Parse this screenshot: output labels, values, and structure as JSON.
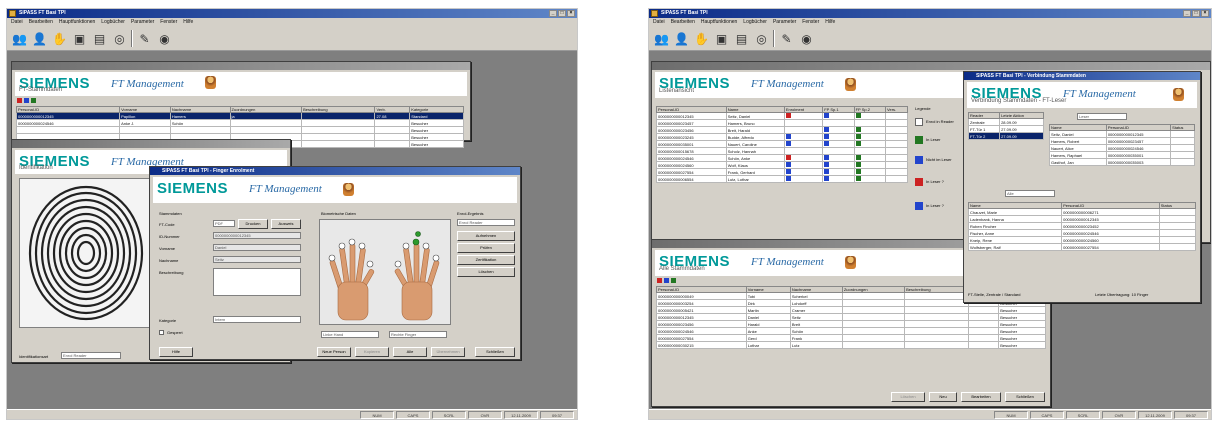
{
  "left": {
    "main_title": "SIPASS FT Basi TPI",
    "menu": [
      "Datei",
      "Bearbeiten",
      "Hauptfunktionen",
      "Logbücher",
      "Parameter",
      "Fenster",
      "Hilfe"
    ],
    "toolbar_icons": [
      "users-icon",
      "person-icon",
      "hands-icon",
      "device-icon",
      "building-icon",
      "disc-icon",
      "separator",
      "book-icon",
      "globe-icon"
    ],
    "brand": "SIEMENS",
    "product": "FT Management",
    "person_window": {
      "subtitle": "FT-Stammdaten",
      "columns": [
        "Personal-ID",
        "Vorname",
        "Nachname",
        "Zuordnungen",
        "Beschreibung",
        "Verb.",
        "Kategorie"
      ],
      "rows": [
        [
          "0000000000012345",
          "Papillon",
          "Hamers",
          "ja",
          "",
          "27.08",
          "Standard"
        ],
        [
          "0000000000024546",
          "Anke J.",
          "Schön",
          "",
          "",
          "",
          "Besucher"
        ],
        [
          "",
          "",
          "",
          "",
          "",
          "",
          "Besucher"
        ],
        [
          "",
          "",
          "",
          "",
          "",
          "",
          "Besucher"
        ],
        [
          "",
          "",
          "",
          "",
          "",
          "",
          "Besucher"
        ]
      ]
    },
    "ident_window": {
      "subtitle": "Identifikation",
      "field_label": "Identifikationsart",
      "field_value": "Enrol Reader"
    },
    "enrol_window": {
      "title": "SIPASS FT Basi TPI - Finger Enrolment",
      "subtitle": "Stammdaten",
      "group_left": "Stammdaten",
      "group_right": "Biometrische Daten",
      "labels": [
        "FT-Code",
        "ID-Nummer",
        "Vorname",
        "Nachname",
        "Beschreibung",
        "Kategorie"
      ],
      "values": [
        "PDF",
        "0000000000012345",
        "Daniel",
        "Seitz",
        "",
        "Intern"
      ],
      "code_buttons": [
        "Drucken",
        "Ausweis"
      ],
      "checkbox_label": "Gesperrt",
      "enrol_label": "Enrol-Ergebnis",
      "enrol_value": "Enrol Reader",
      "side_buttons": [
        "Aufnehmen",
        "Prüfen",
        "Zertifikation",
        "Löschen"
      ],
      "finger_left": "Linke Hand",
      "finger_right": "Rechte Finger",
      "bottom_buttons": [
        "Hilfe",
        "Neue Person",
        "Kopieren",
        "Alle",
        "Übernehmen",
        "Schließen"
      ]
    },
    "status": [
      "NUM",
      "CAPS",
      "SCRL",
      "OVR",
      "12.11.2009",
      "09:37"
    ]
  },
  "right": {
    "main_title": "SIPASS FT Basi TPI",
    "menu": [
      "Datei",
      "Bearbeiten",
      "Hauptfunktionen",
      "Logbücher",
      "Parameter",
      "Fenster",
      "Hilfe"
    ],
    "toolbar_icons": [
      "users-icon",
      "person-icon",
      "hands-icon",
      "device-icon",
      "building-icon",
      "disc-icon",
      "separator",
      "book-icon",
      "globe-icon"
    ],
    "brand": "SIEMENS",
    "product": "FT Management",
    "list_window": {
      "subtitle": "Listenansicht",
      "columns": [
        "Personal-ID",
        "Name",
        "Enrolment",
        "FP Sp.1",
        "FP Sp.2",
        "Vers."
      ],
      "rows": [
        [
          "0000000000012345",
          "Seitz, Daniel",
          "red",
          "blue",
          "green"
        ],
        [
          "0000000000023457",
          "Hamers, Bruno",
          "",
          "",
          ""
        ],
        [
          "0000000000023456",
          "Breit, Harald",
          "",
          "blue",
          "green"
        ],
        [
          "0000000000023245",
          "Budde, Alfredo",
          "blue",
          "blue",
          "green"
        ],
        [
          "0000000000035001",
          "Nauert, Caroline",
          "blue",
          "blue",
          "green"
        ],
        [
          "0000000000015678",
          "Scholz, Hannah",
          "",
          "",
          ""
        ],
        [
          "0000000000024546",
          "Schön, Anke",
          "red",
          "blue",
          "green"
        ],
        [
          "0000000000024560",
          "Wolf, Klaus",
          "blue",
          "blue",
          "green"
        ],
        [
          "0000000000027554",
          "Frank, Gerhard",
          "blue",
          "blue",
          "green"
        ],
        [
          "0000000000006554",
          "Lutz, Lothar",
          "blue",
          "blue",
          "green"
        ]
      ],
      "legend_title": "Legende",
      "legend": [
        "Enrol in Reader",
        "In Leser",
        "Nicht im Leser",
        "In Leser ?",
        "In Leser ?"
      ]
    },
    "assign_window": {
      "title": "SIPASS FT Basi TPI - Verbindung Stammdaten",
      "subtitle": "Verbindung Stammdaten - FT-Leser",
      "tree_columns": [
        "Reader",
        "Letzte Aktion"
      ],
      "tree_items": [
        [
          "Zentrale",
          "28.09.09"
        ],
        [
          "FT-Tür 1",
          "27.09.09"
        ],
        [
          "FT-Tür 2",
          "27.09.09"
        ]
      ],
      "filter_value": "Leser",
      "people_columns": [
        "Name",
        "Personal-ID",
        "Status"
      ],
      "people": [
        [
          "Seitz, Daniel",
          "0000000000012345"
        ],
        [
          "Hamers, Robert",
          "0000000000023457"
        ],
        [
          "Nauert, Alice",
          "0000000000024546"
        ],
        [
          "Hamers, Raphael",
          "0000000000035001"
        ],
        [
          "Gasthof, Jan",
          "0000000000035003"
        ]
      ],
      "filter2_value": "Alle",
      "people2": [
        [
          "Chauvet, Marie",
          "0000000000006271"
        ],
        [
          "Ladenbank, Hanna",
          "0000000000012345"
        ],
        [
          "Ruben Fincher",
          "0000000000023452"
        ],
        [
          "Fischer, Anne",
          "0000000000024546"
        ],
        [
          "Kneip, Rene",
          "0000000000024560"
        ],
        [
          "Wolfsberger, Ralf",
          "0000000000027554"
        ]
      ],
      "foot_left": "FT-Stelle, Zentrale / Standard",
      "foot_right": "Letzte Übertragung: 10 Finger"
    },
    "bottom_window": {
      "subtitle": "Alle Stammdaten",
      "columns": [
        "Personal-ID",
        "Vorname",
        "Nachname",
        "Zuordnungen",
        "Beschreibung",
        "Verb.",
        "Kategorie"
      ],
      "rows": [
        [
          "0000000000000049",
          "Tobi",
          "Scherkel",
          "",
          "",
          "27.08",
          "Besucher"
        ],
        [
          "0000000000003254",
          "Dirk",
          "Lohdorff",
          "",
          "",
          "",
          "Besucher"
        ],
        [
          "0000000000005421",
          "Martin",
          "Cramer",
          "",
          "",
          "",
          "Besucher"
        ],
        [
          "0000000000012345",
          "Daniel",
          "Seitz",
          "",
          "",
          "",
          "Besucher"
        ],
        [
          "0000000000023456",
          "Harald",
          "Breit",
          "",
          "",
          "",
          "Besucher"
        ],
        [
          "0000000000024546",
          "Anke",
          "Schön",
          "",
          "",
          "",
          "Besucher"
        ],
        [
          "0000000000027554",
          "Gerd",
          "Frank",
          "",
          "",
          "",
          "Besucher"
        ],
        [
          "0000000000030215",
          "Lothar",
          "Lutz",
          "",
          "",
          "",
          "Besucher"
        ]
      ],
      "buttons": [
        "Löschen",
        "Neu",
        "Bearbeiten",
        "Schließen"
      ]
    },
    "status": [
      "NUM",
      "CAPS",
      "SCRL",
      "OVR",
      "12.11.2009",
      "09:37"
    ]
  }
}
